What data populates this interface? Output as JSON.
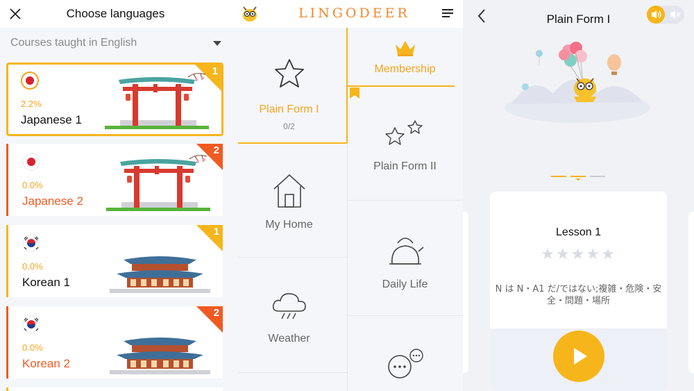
{
  "colors": {
    "accent_yellow": "#f6b51b",
    "accent_orange": "#f15a22",
    "background": "#f5f6fa"
  },
  "panel_languages": {
    "title": "Choose languages",
    "close_icon": "close-icon",
    "filter": {
      "label": "Courses taught in English",
      "icon": "caret-down-icon"
    },
    "courses": [
      {
        "name": "Japanese 1",
        "progress": "2.2%",
        "level": "1",
        "flag": "japan-flag-icon",
        "selected": true
      },
      {
        "name": "Japanese 2",
        "progress": "0.0%",
        "level": "2",
        "flag": "japan-flag-icon",
        "selected": false
      },
      {
        "name": "Korean 1",
        "progress": "0.0%",
        "level": "1",
        "flag": "korea-flag-icon",
        "selected": false
      },
      {
        "name": "Korean 2",
        "progress": "0.0%",
        "level": "2",
        "flag": "korea-flag-icon",
        "selected": false
      }
    ]
  },
  "panel_units": {
    "logo": "LINGODEER",
    "menu_icon": "menu-icon",
    "units": [
      {
        "label": "Plain Form I",
        "progress": "0/2",
        "icon": "star-icon",
        "active": true
      },
      {
        "label": "Membership",
        "icon": "crown-icon"
      },
      {
        "label": "Plain Form II",
        "icon": "stars-icon"
      },
      {
        "label": "My Home",
        "icon": "house-icon"
      },
      {
        "label": "Daily Life",
        "icon": "kettle-icon"
      },
      {
        "label": "Weather",
        "icon": "rain-cloud-icon"
      },
      {
        "label": "",
        "icon": "chat-bubbles-icon"
      }
    ]
  },
  "panel_lesson": {
    "title": "Plain Form I",
    "back_icon": "back-chevron-icon",
    "sound_on_icon": "speaker-on-icon",
    "sound_off_icon": "speaker-off-icon",
    "lesson": {
      "title": "Lesson 1",
      "stars": "★★★★★",
      "description": "N は N・A1 だ/ではない;複雑・危険・安全・問題・場所",
      "play_icon": "play-icon"
    }
  }
}
